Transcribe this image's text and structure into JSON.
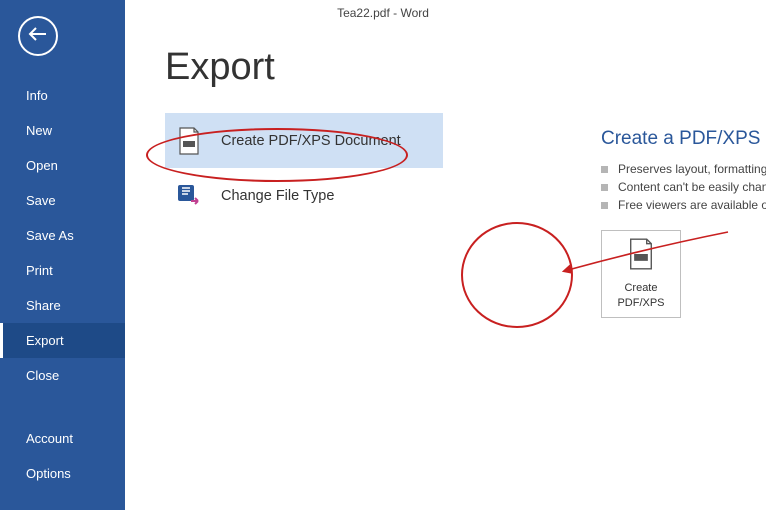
{
  "titlebar": "Tea22.pdf - Word",
  "page_title": "Export",
  "sidebar": {
    "items": [
      {
        "label": "Info",
        "selected": false
      },
      {
        "label": "New",
        "selected": false
      },
      {
        "label": "Open",
        "selected": false
      },
      {
        "label": "Save",
        "selected": false
      },
      {
        "label": "Save As",
        "selected": false
      },
      {
        "label": "Print",
        "selected": false
      },
      {
        "label": "Share",
        "selected": false
      },
      {
        "label": "Export",
        "selected": true
      },
      {
        "label": "Close",
        "selected": false
      }
    ],
    "footer_items": [
      {
        "label": "Account"
      },
      {
        "label": "Options"
      }
    ]
  },
  "export_options": [
    {
      "label": "Create PDF/XPS Document",
      "icon": "pdf-page-icon",
      "selected": true
    },
    {
      "label": "Change File Type",
      "icon": "change-type-icon",
      "selected": false
    }
  ],
  "right_panel": {
    "heading": "Create a PDF/XPS Document",
    "bullets": [
      "Preserves layout, formatting, fonts, and images",
      "Content can't be easily changed",
      "Free viewers are available on the web"
    ],
    "button_line1": "Create",
    "button_line2": "PDF/XPS"
  },
  "colors": {
    "sidebar_bg": "#2a579a",
    "selected_option_bg": "#cfe0f4",
    "annotation": "#c82020"
  }
}
